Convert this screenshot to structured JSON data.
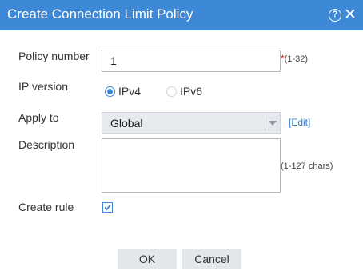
{
  "dialog": {
    "title": "Create Connection Limit Policy",
    "help_icon": "help-circle-icon",
    "help_glyph": "?",
    "close_icon": "close-icon",
    "close_glyph": "✕",
    "accent_color": "#3d89d8"
  },
  "form": {
    "policy_number": {
      "label": "Policy number",
      "value": "1",
      "required_mark": "*",
      "range_hint": "(1-32)"
    },
    "ip_version": {
      "label": "IP version",
      "options": [
        "IPv4",
        "IPv6"
      ],
      "selected": "IPv4"
    },
    "apply_to": {
      "label": "Apply to",
      "selected": "Global",
      "edit_link": "[Edit]"
    },
    "description": {
      "label": "Description",
      "value": "",
      "hint": "(1-127 chars)"
    },
    "create_rule": {
      "label": "Create rule",
      "checked": true
    }
  },
  "buttons": {
    "ok": "OK",
    "cancel": "Cancel"
  }
}
